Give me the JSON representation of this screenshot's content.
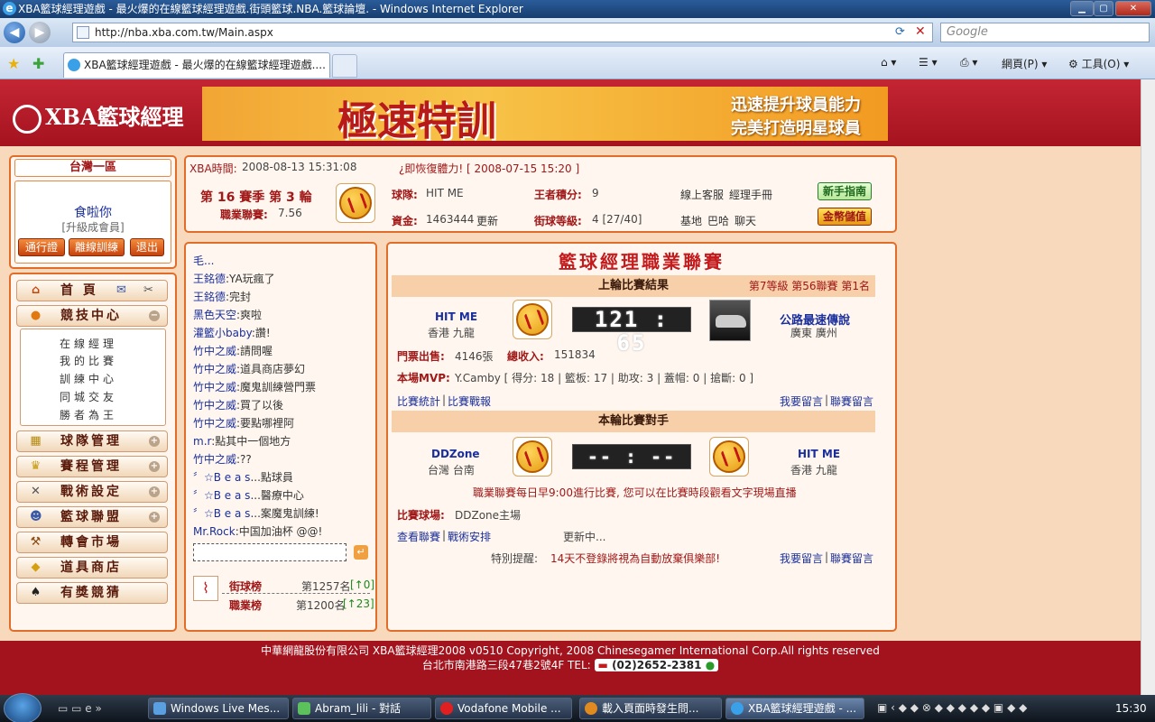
{
  "window": {
    "title": "XBA籃球經理遊戲 - 最火爆的在線籃球經理遊戲.街頭籃球.NBA.籃球論壇. - Windows Internet Explorer",
    "url": "http://nba.xba.com.tw/Main.aspx",
    "search_placeholder": "Google",
    "tab_title": "XBA籃球經理遊戲 - 最火爆的在線籃球經理遊戲....",
    "menu_page": "網頁(P)",
    "menu_tools": "工具(O)"
  },
  "header": {
    "logo_text": "XBA籃球經理",
    "banner_title": "極速特訓",
    "banner_line1": "迅速提升球員能力",
    "banner_line2": "完美打造明星球員"
  },
  "user": {
    "server": "台灣一區",
    "name": "食啦你",
    "upgrade": "[升級成會員]",
    "btn_pass": "通行證",
    "btn_offline": "離線訓練",
    "btn_logout": "退出"
  },
  "menu": {
    "home": "首 頁",
    "arena": "競技中心",
    "arena_sub": [
      "在線經理",
      "我的比賽",
      "訓練中心",
      "同城交友",
      "勝者為王"
    ],
    "team": "球隊管理",
    "schedule": "賽程管理",
    "tactics": "戰術設定",
    "league": "籃球聯盟",
    "transfer": "轉會市場",
    "shop": "道具商店",
    "lottery": "有獎競猜"
  },
  "status": {
    "time_label": "XBA時間:",
    "time_value": "2008-08-13 15:31:08",
    "recover": "¿即恢復體力! [ 2008-07-15 15:20 ]",
    "season": "第 16 賽季 第 3 輪",
    "league_label": "職業聯賽:",
    "league_value": "7.56",
    "team_label": "球隊:",
    "team_value": "HIT ME",
    "king_label": "王者積分:",
    "king_value": "9",
    "service": "線上客服",
    "manual": "經理手冊",
    "funds_label": "資金:",
    "funds_value": "1463444",
    "refresh": "更新",
    "street_label": "街球等級:",
    "street_value": "4 [27/40]",
    "base": "基地",
    "baha": "巴哈",
    "chat": "聊天",
    "guide_btn": "新手指南",
    "gold_btn": "金幣儲值"
  },
  "chat": [
    {
      "name": "毛...",
      "msg": ""
    },
    {
      "name": "王銘德",
      "msg": ":YA玩瘋了"
    },
    {
      "name": "王銘德",
      "msg": ":完封"
    },
    {
      "name": "黑色天空",
      "msg": ":爽啦"
    },
    {
      "name": "灌籃小baby",
      "msg": ":讚!"
    },
    {
      "name": "竹中之威",
      "msg": ":請問喔"
    },
    {
      "name": "竹中之威",
      "msg": ":道具商店夢幻"
    },
    {
      "name": "竹中之威",
      "msg": ":魔鬼訓練營門票"
    },
    {
      "name": "竹中之威",
      "msg": ":買了以後"
    },
    {
      "name": "竹中之威",
      "msg": ":要點哪裡阿"
    },
    {
      "name": "m.r",
      "msg": ":點其中一個地方"
    },
    {
      "name": "竹中之威",
      "msg": ":??"
    },
    {
      "name": "〞☆B e a s",
      "msg": "...點球員"
    },
    {
      "name": "〞☆B e a s",
      "msg": "...醫療中心"
    },
    {
      "name": "〞☆B e a s",
      "msg": "...案魔鬼訓練!"
    },
    {
      "name": "Mr.Rock",
      "msg": ":中国加油杯 @@!"
    }
  ],
  "ranks": {
    "street_label": "街球榜",
    "street_value": "第1257名",
    "street_delta": "[↑0]",
    "league_label": "職業榜",
    "league_value": "第1200名",
    "league_delta": "[↑23]"
  },
  "league": {
    "title": "籃球經理職業聯賽",
    "last_title": "上輪比賽結果",
    "last_rank": "第7等級 第56聯賽 第1名",
    "home_name": "HIT ME",
    "home_city": "香港 九龍",
    "score": "121 : 65",
    "away_name": "公路最速傳說",
    "away_city": "廣東 廣州",
    "tickets_label": "門票出售:",
    "tickets_value": "4146張",
    "income_label": "總收入:",
    "income_value": "151834",
    "mvp_label": "本場MVP:",
    "mvp_value": "Y.Camby [ 得分: 18 | 籃板: 17 | 助攻: 3 | 蓋帽: 0 | 搶斷: 0 ]",
    "stats_link": "比賽統計",
    "report_link": "比賽戰報",
    "comment_link": "我要留言",
    "league_comment_link": "聯賽留言",
    "next_title": "本輪比賽對手",
    "next_home_name": "DDZone",
    "next_home_city": "台灣 台南",
    "next_score": "-- : --",
    "next_away_name": "HIT ME",
    "next_away_city": "香港 九龍",
    "notice": "職業聯賽每日早9:00進行比賽, 您可以在比賽時段觀看文字現場直播",
    "venue_label": "比賽球場:",
    "venue_value": "DDZone主場",
    "view_league": "查看聯賽",
    "tactic_link": "戰術安排",
    "updating": "更新中...",
    "reminder_label": "特別提醒:",
    "reminder_value": "14天不登錄將視為自動放棄俱樂部!"
  },
  "footer": {
    "line1": "中華網龍股份有限公司  XBA籃球經理2008 v0510    Copyright, 2008 Chinesegamer International Corp.All rights reserved",
    "line2": "台北市南港路三段47巷2號4F TEL:",
    "tel": "(02)2652-2381"
  },
  "taskbar": {
    "items": [
      "Windows Live Mes...",
      "Abram_lili - 對話",
      "Vodafone Mobile ...",
      "載入頁面時發生問...",
      "XBA籃球經理遊戲 - ..."
    ],
    "clock": "15:30"
  }
}
